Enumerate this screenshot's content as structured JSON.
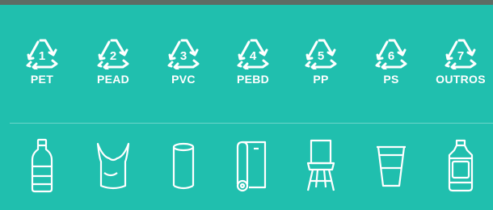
{
  "codes": [
    {
      "number": "1",
      "label": "PET"
    },
    {
      "number": "2",
      "label": "PEAD"
    },
    {
      "number": "3",
      "label": "PVC"
    },
    {
      "number": "4",
      "label": "PEBD"
    },
    {
      "number": "5",
      "label": "PP"
    },
    {
      "number": "6",
      "label": "PS"
    },
    {
      "number": "7",
      "label": "OUTROS"
    }
  ],
  "products": [
    {
      "icon": "bottle-icon"
    },
    {
      "icon": "plastic-bag-icon"
    },
    {
      "icon": "pipe-icon"
    },
    {
      "icon": "plastic-film-roll-icon"
    },
    {
      "icon": "chair-icon"
    },
    {
      "icon": "cup-icon"
    },
    {
      "icon": "water-jug-icon"
    }
  ],
  "colors": {
    "background": "#20bfae",
    "foreground": "#ffffff",
    "frame": "#5e6b64"
  }
}
